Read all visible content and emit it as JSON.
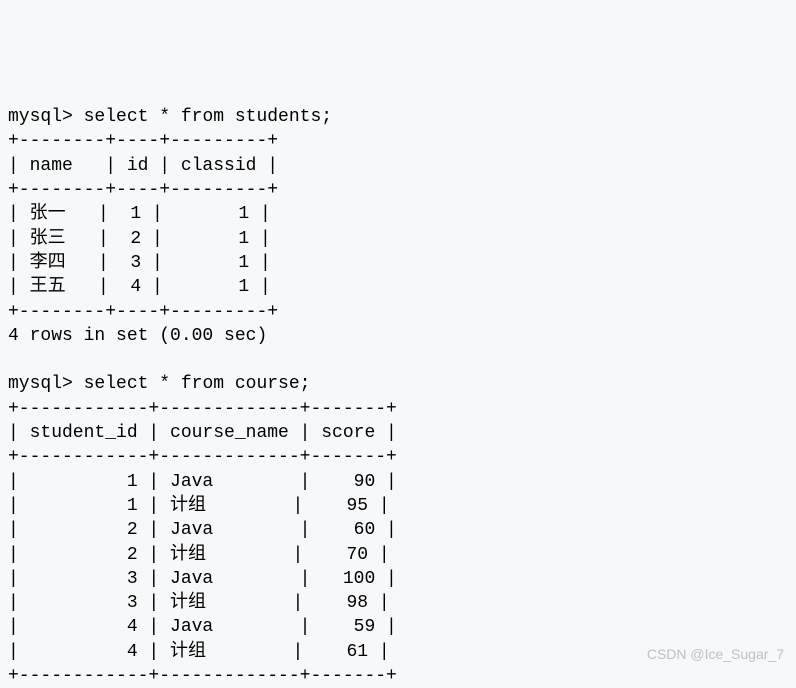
{
  "query1": {
    "prompt": "mysql> ",
    "sql": "select * from students;",
    "border": "+--------+----+---------+",
    "header": "| name   | id | classid |",
    "rows": [
      "| 张一   |  1 |       1 |",
      "| 张三   |  2 |       1 |",
      "| 李四   |  3 |       1 |",
      "| 王五   |  4 |       1 |"
    ],
    "footer": "4 rows in set (0.00 sec)"
  },
  "query2": {
    "prompt": "mysql> ",
    "sql": "select * from course;",
    "border": "+------------+-------------+-------+",
    "header": "| student_id | course_name | score |",
    "rows": [
      "|          1 | Java        |    90 |",
      "|          1 | 计组        |    95 |",
      "|          2 | Java        |    60 |",
      "|          2 | 计组        |    70 |",
      "|          3 | Java        |   100 |",
      "|          3 | 计组        |    98 |",
      "|          4 | Java        |    59 |",
      "|          4 | 计组        |    61 |"
    ]
  },
  "watermark": "CSDN @Ice_Sugar_7",
  "chart_data": [
    {
      "type": "table",
      "title": "students",
      "columns": [
        "name",
        "id",
        "classid"
      ],
      "rows": [
        [
          "张一",
          1,
          1
        ],
        [
          "张三",
          2,
          1
        ],
        [
          "李四",
          3,
          1
        ],
        [
          "王五",
          4,
          1
        ]
      ],
      "row_count": 4,
      "elapsed_sec": 0.0
    },
    {
      "type": "table",
      "title": "course",
      "columns": [
        "student_id",
        "course_name",
        "score"
      ],
      "rows": [
        [
          1,
          "Java",
          90
        ],
        [
          1,
          "计组",
          95
        ],
        [
          2,
          "Java",
          60
        ],
        [
          2,
          "计组",
          70
        ],
        [
          3,
          "Java",
          100
        ],
        [
          3,
          "计组",
          98
        ],
        [
          4,
          "Java",
          59
        ],
        [
          4,
          "计组",
          61
        ]
      ]
    }
  ]
}
